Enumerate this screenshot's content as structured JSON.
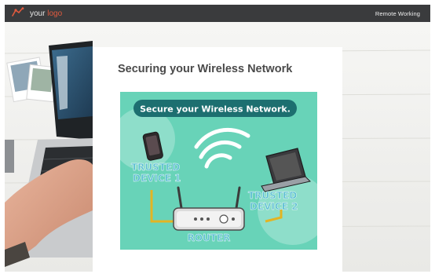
{
  "header": {
    "logo_text_prefix": "your",
    "logo_text_accent": "logo",
    "nav_link": "Remote Working",
    "logo_icon": "sprout-logo-icon",
    "colors": {
      "bar": "#3a3b3d",
      "accent": "#e15a3e"
    }
  },
  "article": {
    "title": "Securing your Wireless Network"
  },
  "infographic": {
    "banner": "Secure your Wireless Network.",
    "label_trusted_1_line1": "TRUSTED",
    "label_trusted_1_line2": "DEVICE 1",
    "label_trusted_2_line1": "TRUSTED",
    "label_trusted_2_line2": "DEVICE 2",
    "label_router": "ROUTER",
    "colors": {
      "background": "#68d3b8",
      "banner": "#1d6f70",
      "router": "#5cbfd2",
      "wire": "#e3b423"
    }
  }
}
